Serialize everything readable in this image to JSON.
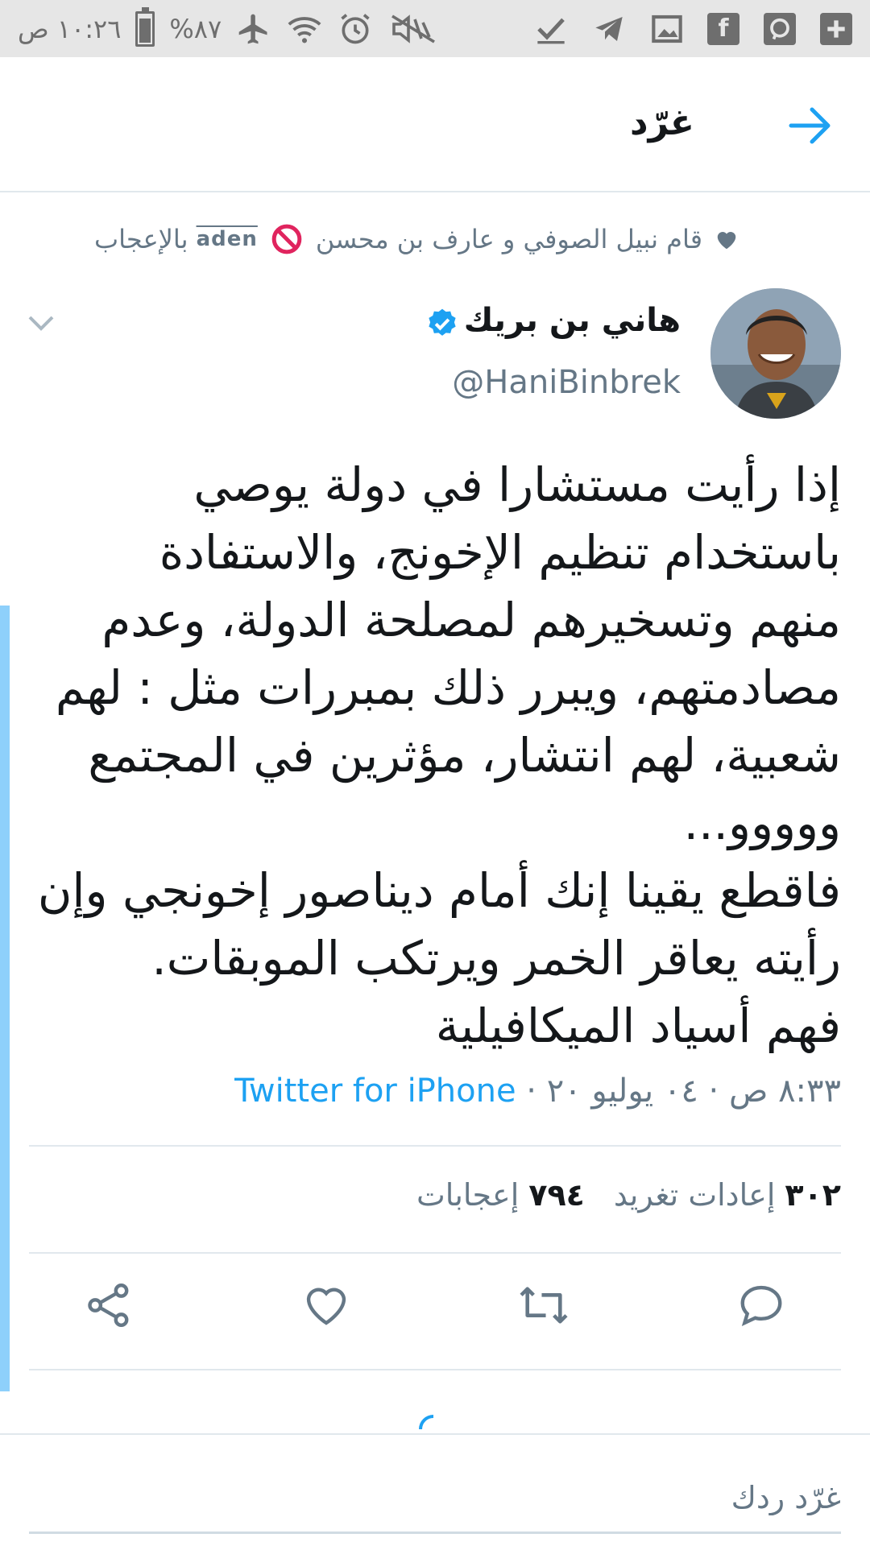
{
  "status_bar": {
    "time": "١٠:٢٦ ص",
    "battery": "%٨٧",
    "battery_level": 0.87,
    "icons": [
      "airplane-icon",
      "wifi-icon",
      "alarm-icon",
      "mute-icon",
      "check-icon",
      "telegram-icon",
      "gallery-icon",
      "facebook-icon",
      "messenger-icon",
      "plus-icon"
    ]
  },
  "header": {
    "title": "غرّد"
  },
  "liked_by": {
    "text": "قام نبيل الصوفي و عارف بن محسن",
    "badge": "aden",
    "suffix": "بالإعجاب"
  },
  "tweet": {
    "author_name": "هاني بن بريك",
    "handle": "@HaniBinbrek",
    "text": "إذا رأيت مستشارا في دولة يوصي\nباستخدام تنظيم الإخونج، والاستفادة\nمنهم وتسخيرهم لمصلحة الدولة، وعدم\nمصادمتهم، ويبرر ذلك بمبررات مثل : لهم\nشعبية، لهم انتشار، مؤثرين في المجتمع\nووووو...\nفاقطع يقينا إنك أمام ديناصور إخونجي وإن\nرأيته يعاقر الخمر ويرتكب الموبقات.\nفهم أسياد الميكافيلية",
    "meta_time": "٨:٣٣ ص · ٠٤ يوليو ٢٠ · ",
    "meta_source": "Twitter for iPhone",
    "retweets_count": "٣٠٢",
    "retweets_label": "إعادات تغريد",
    "likes_count": "٧٩٤",
    "likes_label": "إعجابات"
  },
  "actions": {
    "items": [
      "reply-icon",
      "retweet-icon",
      "like-icon",
      "share-icon"
    ]
  },
  "reply": {
    "placeholder": "غرّد ردك"
  },
  "colors": {
    "accent": "#1da1f2",
    "thread_line": "#8ed0fb",
    "muted": "#657786",
    "status_bar": "#e6e6e6"
  }
}
